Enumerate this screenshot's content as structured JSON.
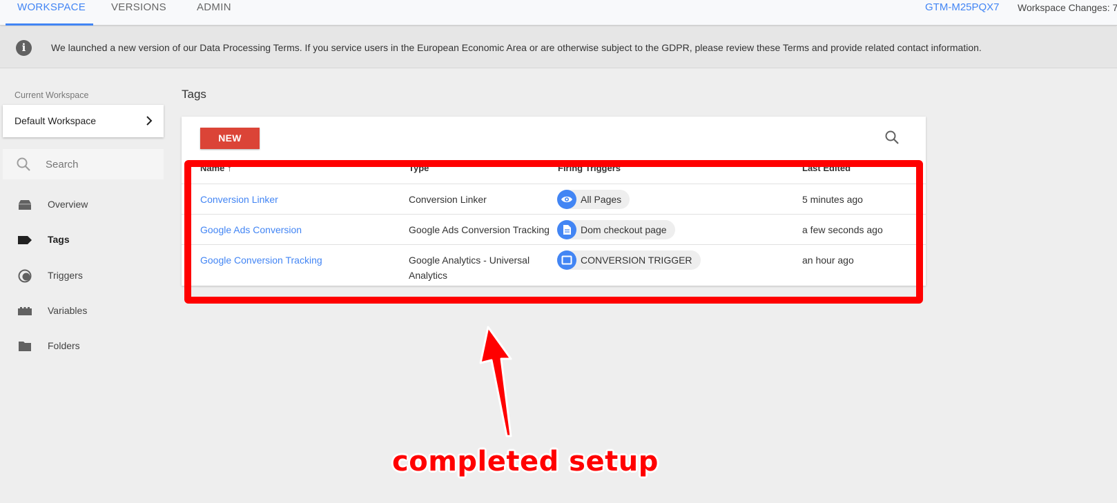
{
  "topnav": {
    "tabs": [
      {
        "label": "WORKSPACE",
        "active": true
      },
      {
        "label": "VERSIONS",
        "active": false
      },
      {
        "label": "ADMIN",
        "active": false
      }
    ],
    "container_id": "GTM-M25PQX7",
    "workspace_changes": "Workspace Changes: 7"
  },
  "banner": {
    "icon": "info-icon",
    "message": "We launched a new version of our Data Processing Terms. If you service users in the European Economic Area or are otherwise subject to the GDPR, please review these Terms and provide related contact information."
  },
  "sidebar": {
    "current_workspace_label": "Current Workspace",
    "workspace_name": "Default Workspace",
    "search_placeholder": "Search",
    "items": [
      {
        "label": "Overview",
        "icon": "overview-icon",
        "active": false
      },
      {
        "label": "Tags",
        "icon": "tag-icon",
        "active": true
      },
      {
        "label": "Triggers",
        "icon": "trigger-icon",
        "active": false
      },
      {
        "label": "Variables",
        "icon": "variables-icon",
        "active": false
      },
      {
        "label": "Folders",
        "icon": "folder-icon",
        "active": false
      }
    ]
  },
  "main": {
    "title": "Tags",
    "new_button": "NEW",
    "columns": {
      "name": "Name ↑",
      "type": "Type",
      "triggers": "Firing Triggers",
      "last_edited": "Last Edited"
    },
    "rows": [
      {
        "name": "Conversion Linker",
        "type": "Conversion Linker",
        "trigger": "All Pages",
        "trigger_icon": "eye-icon",
        "last_edited": "5 minutes ago"
      },
      {
        "name": "Google Ads Conversion",
        "type": "Google Ads Conversion Tracking",
        "trigger": "Dom checkout page",
        "trigger_icon": "document-icon",
        "last_edited": "a few seconds ago"
      },
      {
        "name": "Google Conversion Tracking",
        "type_line1": "Google Analytics - Universal",
        "type_line2": "Analytics",
        "trigger": "CONVERSION TRIGGER",
        "trigger_icon": "window-icon",
        "last_edited": "an hour ago"
      }
    ]
  },
  "annotation": {
    "text": "completed setup",
    "color": "#ff0000"
  },
  "colors": {
    "accent": "#4285f4",
    "new_button": "#db4437",
    "annotation": "#ff0000"
  }
}
